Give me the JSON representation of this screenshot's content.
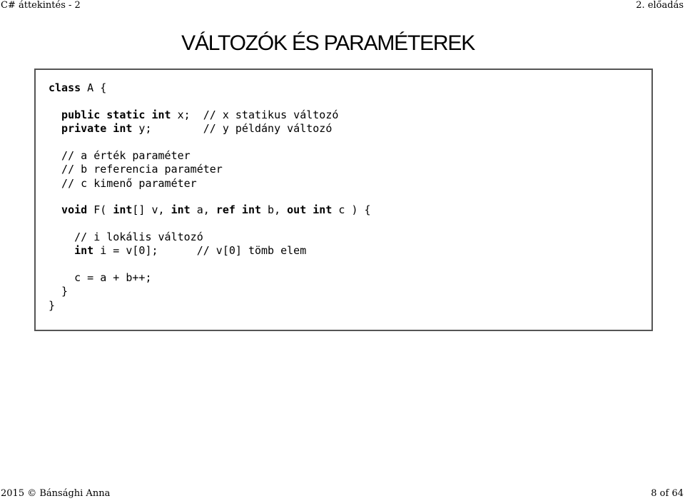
{
  "header": {
    "left": "C# áttekintés - 2",
    "right": "2. előadás"
  },
  "slide": {
    "title": "VÁLTOZÓK ÉS PARAMÉTEREK"
  },
  "code": {
    "l1_kw": "class",
    "l1_rest": " A {",
    "l2_kw": "  public static int",
    "l2_rest": " x;  // x statikus változó",
    "l3_kw": "  private int",
    "l3_rest": " y;        // y példány változó",
    "l4": "  // a érték paraméter",
    "l5": "  // b referencia paraméter",
    "l6": "  // c kimenő paraméter",
    "l7_kw1": "  void",
    "l7_t1": " F( ",
    "l7_kw2": "int",
    "l7_t2": "[] v, ",
    "l7_kw3": "int",
    "l7_t3": " a, ",
    "l7_kw4": "ref int",
    "l7_t4": " b, ",
    "l7_kw5": "out int",
    "l7_t5": " c ) {",
    "l8": "    // i lokális változó",
    "l9_kw": "    int",
    "l9_rest": " i = v[0];      // v[0] tömb elem",
    "l10": "    c = a + b++;",
    "l11": "  }",
    "l12": "}"
  },
  "footer": {
    "left": "2015 © Bánsághi Anna",
    "right": "8 of 64"
  }
}
